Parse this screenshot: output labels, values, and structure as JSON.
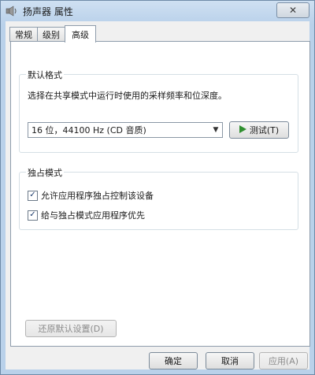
{
  "window": {
    "title": "扬声器 属性",
    "close_glyph": "✕"
  },
  "tabs": [
    {
      "label": "常规",
      "active": false
    },
    {
      "label": "级别",
      "active": false
    },
    {
      "label": "高级",
      "active": true
    }
  ],
  "default_format": {
    "label": "默认格式",
    "description": "选择在共享模式中运行时使用的采样频率和位深度。",
    "selected_value": "16 位，44100 Hz (CD 音质)",
    "test_button": "测试(T)"
  },
  "exclusive_mode": {
    "label": "独占模式",
    "options": [
      {
        "label": "允许应用程序独占控制该设备",
        "checked": true
      },
      {
        "label": "给与独占模式应用程序优先",
        "checked": true
      }
    ]
  },
  "restore_button": "还原默认设置(D)",
  "footer": {
    "ok": "确定",
    "cancel": "取消",
    "apply": "应用(A)"
  },
  "colors": {
    "title_gradient": "#b9d1ea",
    "play_green": "#2f8f2f"
  }
}
